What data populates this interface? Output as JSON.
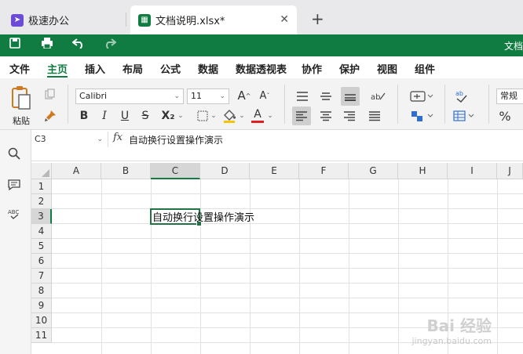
{
  "tabs": [
    {
      "label": "极速办公",
      "icon": "rocket-icon",
      "color": "#6c4bd6"
    },
    {
      "label": "文档说明.xlsx*",
      "icon": "spreadsheet-icon",
      "color": "#107c41"
    }
  ],
  "quick": {
    "doc_title": "文档"
  },
  "menu": [
    "文件",
    "主页",
    "插入",
    "布局",
    "公式",
    "数据",
    "数据透视表",
    "协作",
    "保护",
    "视图",
    "组件"
  ],
  "ribbon": {
    "paste_label": "粘贴",
    "font_name": "Calibri",
    "font_size": "11",
    "number_format": "常规",
    "bold": "B",
    "italic": "I",
    "underline": "U",
    "strike": "S",
    "subscript": "X₂",
    "font_grow": "A",
    "font_shrink": "A",
    "font_color": "A",
    "percent": "%"
  },
  "formula": {
    "cell_ref": "C3",
    "fx": "fx",
    "content": "自动换行设置操作演示"
  },
  "columns": [
    "A",
    "B",
    "C",
    "D",
    "E",
    "F",
    "G",
    "H",
    "I",
    "J"
  ],
  "rows": [
    "1",
    "2",
    "3",
    "4",
    "5",
    "6",
    "7",
    "8",
    "9",
    "10",
    "11"
  ],
  "cell_c3": "自动换行设置操作演示",
  "watermark": {
    "line1": "Bai 经验",
    "line2": "jingyan.baidu.com"
  },
  "colors": {
    "accent": "#107c41"
  }
}
